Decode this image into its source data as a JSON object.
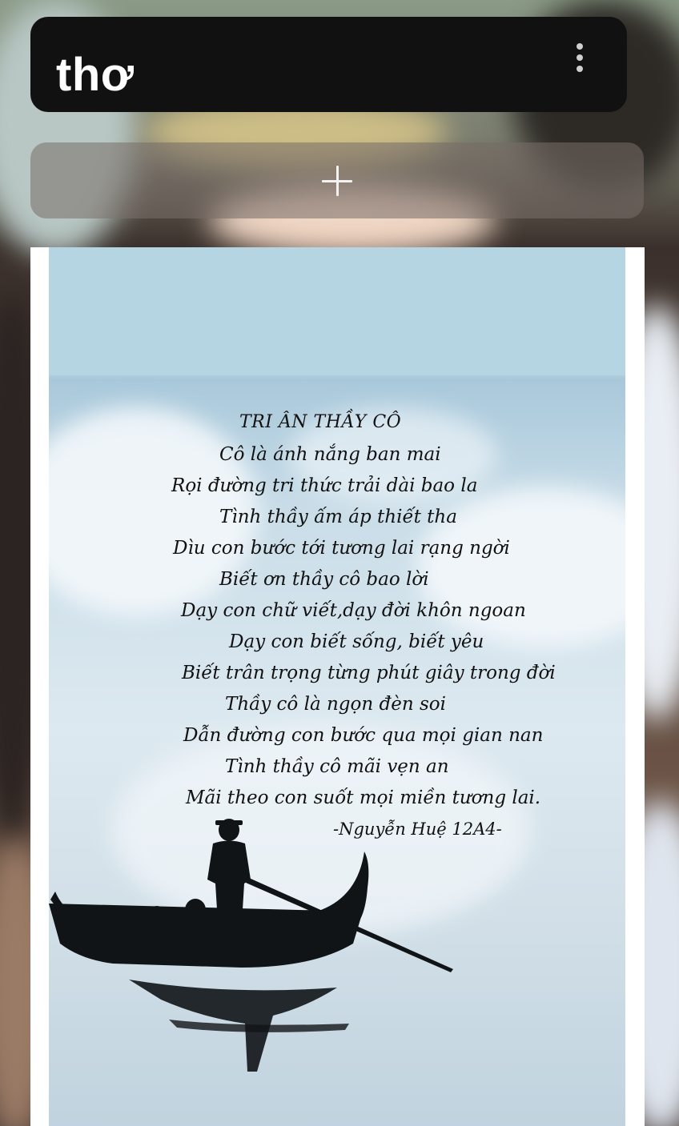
{
  "header": {
    "title": "thơ"
  },
  "poem": {
    "title": "TRI ÂN THẦY CÔ",
    "lines": [
      "Cô là ánh nắng ban mai",
      "Rọi đường tri thức trải dài bao la",
      "Tình thầy ấm áp thiết tha",
      "Dìu con bước tới tương lai rạng ngời",
      "Biết ơn thầy cô bao lời",
      "Dạy con chữ viết,dạy đời khôn ngoan",
      "Dạy con biết sống, biết yêu",
      "Biết trân trọng từng phút giây trong đời",
      "Thầy cô là ngọn đèn soi",
      "Dẫn đường con bước qua mọi gian nan",
      "Tình thầy cô mãi vẹn an",
      "Mãi theo con suốt mọi miền tương lai."
    ],
    "signature": "-Nguyễn Huệ 12A4-"
  },
  "icons": {
    "more": "more-vertical-icon",
    "add": "plus-icon"
  },
  "colors": {
    "header_bg": "#111111",
    "header_text": "#ffffff",
    "sky": "#b6d5e2"
  }
}
